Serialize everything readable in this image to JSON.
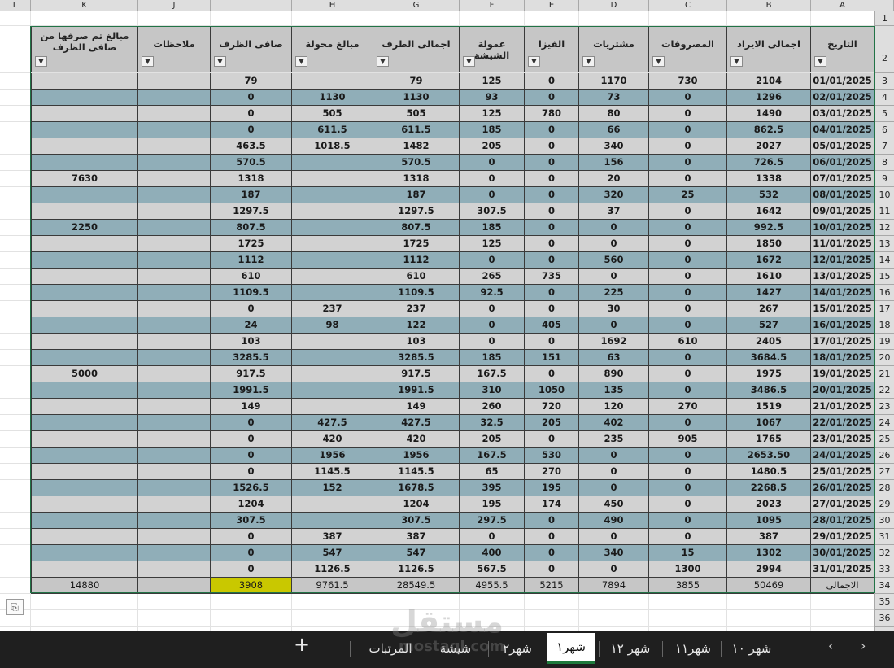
{
  "columns": [
    "L",
    "K",
    "J",
    "I",
    "H",
    "G",
    "F",
    "E",
    "D",
    "C",
    "B",
    "A"
  ],
  "headers": {
    "K": "مبالغ تم صرفها من صافى الظرف",
    "J": "ملاحظات",
    "I": "صافى الظرف",
    "H": "مبالغ محولة",
    "G": "اجمالى الظرف",
    "F": "عمولة الشيشة",
    "E": "الفيزا",
    "D": "مشتريات",
    "C": "المصروفات",
    "B": "اجمالى الايراد",
    "A": "التاريخ"
  },
  "row_numbers": [
    "1",
    "2",
    "3",
    "4",
    "5",
    "6",
    "7",
    "8",
    "9",
    "10",
    "11",
    "12",
    "13",
    "14",
    "15",
    "16",
    "17",
    "18",
    "19",
    "20",
    "21",
    "22",
    "23",
    "24",
    "25",
    "26",
    "27",
    "28",
    "29",
    "30",
    "31",
    "32",
    "33",
    "34",
    "35",
    "36",
    "37"
  ],
  "rows": [
    {
      "A": "01/01/2025",
      "B": "2104",
      "C": "730",
      "D": "1170",
      "E": "0",
      "F": "125",
      "G": "79",
      "H": "",
      "I": "79",
      "J": "",
      "K": ""
    },
    {
      "A": "02/01/2025",
      "B": "1296",
      "C": "0",
      "D": "73",
      "E": "0",
      "F": "93",
      "G": "1130",
      "H": "1130",
      "I": "0",
      "J": "",
      "K": ""
    },
    {
      "A": "03/01/2025",
      "B": "1490",
      "C": "0",
      "D": "80",
      "E": "780",
      "F": "125",
      "G": "505",
      "H": "505",
      "I": "0",
      "J": "",
      "K": ""
    },
    {
      "A": "04/01/2025",
      "B": "862.5",
      "C": "0",
      "D": "66",
      "E": "0",
      "F": "185",
      "G": "611.5",
      "H": "611.5",
      "I": "0",
      "J": "",
      "K": ""
    },
    {
      "A": "05/01/2025",
      "B": "2027",
      "C": "0",
      "D": "340",
      "E": "0",
      "F": "205",
      "G": "1482",
      "H": "1018.5",
      "I": "463.5",
      "J": "",
      "K": ""
    },
    {
      "A": "06/01/2025",
      "B": "726.5",
      "C": "0",
      "D": "156",
      "E": "0",
      "F": "0",
      "G": "570.5",
      "H": "",
      "I": "570.5",
      "J": "",
      "K": ""
    },
    {
      "A": "07/01/2025",
      "B": "1338",
      "C": "0",
      "D": "20",
      "E": "0",
      "F": "0",
      "G": "1318",
      "H": "",
      "I": "1318",
      "J": "",
      "K": "7630"
    },
    {
      "A": "08/01/2025",
      "B": "532",
      "C": "25",
      "D": "320",
      "E": "0",
      "F": "0",
      "G": "187",
      "H": "",
      "I": "187",
      "J": "",
      "K": ""
    },
    {
      "A": "09/01/2025",
      "B": "1642",
      "C": "0",
      "D": "37",
      "E": "0",
      "F": "307.5",
      "G": "1297.5",
      "H": "",
      "I": "1297.5",
      "J": "",
      "K": ""
    },
    {
      "A": "10/01/2025",
      "B": "992.5",
      "C": "0",
      "D": "0",
      "E": "0",
      "F": "185",
      "G": "807.5",
      "H": "",
      "I": "807.5",
      "J": "",
      "K": "2250"
    },
    {
      "A": "11/01/2025",
      "B": "1850",
      "C": "0",
      "D": "0",
      "E": "0",
      "F": "125",
      "G": "1725",
      "H": "",
      "I": "1725",
      "J": "",
      "K": ""
    },
    {
      "A": "12/01/2025",
      "B": "1672",
      "C": "0",
      "D": "560",
      "E": "0",
      "F": "0",
      "G": "1112",
      "H": "",
      "I": "1112",
      "J": "",
      "K": ""
    },
    {
      "A": "13/01/2025",
      "B": "1610",
      "C": "0",
      "D": "0",
      "E": "735",
      "F": "265",
      "G": "610",
      "H": "",
      "I": "610",
      "J": "",
      "K": ""
    },
    {
      "A": "14/01/2025",
      "B": "1427",
      "C": "0",
      "D": "225",
      "E": "0",
      "F": "92.5",
      "G": "1109.5",
      "H": "",
      "I": "1109.5",
      "J": "",
      "K": ""
    },
    {
      "A": "15/01/2025",
      "B": "267",
      "C": "0",
      "D": "30",
      "E": "0",
      "F": "0",
      "G": "237",
      "H": "237",
      "I": "0",
      "J": "",
      "K": ""
    },
    {
      "A": "16/01/2025",
      "B": "527",
      "C": "0",
      "D": "0",
      "E": "405",
      "F": "0",
      "G": "122",
      "H": "98",
      "I": "24",
      "J": "",
      "K": ""
    },
    {
      "A": "17/01/2025",
      "B": "2405",
      "C": "610",
      "D": "1692",
      "E": "0",
      "F": "0",
      "G": "103",
      "H": "",
      "I": "103",
      "J": "",
      "K": ""
    },
    {
      "A": "18/01/2025",
      "B": "3684.5",
      "C": "0",
      "D": "63",
      "E": "151",
      "F": "185",
      "G": "3285.5",
      "H": "",
      "I": "3285.5",
      "J": "",
      "K": ""
    },
    {
      "A": "19/01/2025",
      "B": "1975",
      "C": "0",
      "D": "890",
      "E": "0",
      "F": "167.5",
      "G": "917.5",
      "H": "",
      "I": "917.5",
      "J": "",
      "K": "5000"
    },
    {
      "A": "20/01/2025",
      "B": "3486.5",
      "C": "0",
      "D": "135",
      "E": "1050",
      "F": "310",
      "G": "1991.5",
      "H": "",
      "I": "1991.5",
      "J": "",
      "K": ""
    },
    {
      "A": "21/01/2025",
      "B": "1519",
      "C": "270",
      "D": "120",
      "E": "720",
      "F": "260",
      "G": "149",
      "H": "",
      "I": "149",
      "J": "",
      "K": ""
    },
    {
      "A": "22/01/2025",
      "B": "1067",
      "C": "0",
      "D": "402",
      "E": "205",
      "F": "32.5",
      "G": "427.5",
      "H": "427.5",
      "I": "0",
      "J": "",
      "K": ""
    },
    {
      "A": "23/01/2025",
      "B": "1765",
      "C": "905",
      "D": "235",
      "E": "0",
      "F": "205",
      "G": "420",
      "H": "420",
      "I": "0",
      "J": "",
      "K": ""
    },
    {
      "A": "24/01/2025",
      "B": "2653.50",
      "C": "0",
      "D": "0",
      "E": "530",
      "F": "167.5",
      "G": "1956",
      "H": "1956",
      "I": "0",
      "J": "",
      "K": ""
    },
    {
      "A": "25/01/2025",
      "B": "1480.5",
      "C": "0",
      "D": "0",
      "E": "270",
      "F": "65",
      "G": "1145.5",
      "H": "1145.5",
      "I": "0",
      "J": "",
      "K": ""
    },
    {
      "A": "26/01/2025",
      "B": "2268.5",
      "C": "0",
      "D": "0",
      "E": "195",
      "F": "395",
      "G": "1678.5",
      "H": "152",
      "I": "1526.5",
      "J": "",
      "K": ""
    },
    {
      "A": "27/01/2025",
      "B": "2023",
      "C": "0",
      "D": "450",
      "E": "174",
      "F": "195",
      "G": "1204",
      "H": "",
      "I": "1204",
      "J": "",
      "K": ""
    },
    {
      "A": "28/01/2025",
      "B": "1095",
      "C": "0",
      "D": "490",
      "E": "0",
      "F": "297.5",
      "G": "307.5",
      "H": "",
      "I": "307.5",
      "J": "",
      "K": ""
    },
    {
      "A": "29/01/2025",
      "B": "387",
      "C": "0",
      "D": "0",
      "E": "0",
      "F": "0",
      "G": "387",
      "H": "387",
      "I": "0",
      "J": "",
      "K": ""
    },
    {
      "A": "30/01/2025",
      "B": "1302",
      "C": "15",
      "D": "340",
      "E": "0",
      "F": "400",
      "G": "547",
      "H": "547",
      "I": "0",
      "J": "",
      "K": ""
    },
    {
      "A": "31/01/2025",
      "B": "2994",
      "C": "1300",
      "D": "0",
      "E": "0",
      "F": "567.5",
      "G": "1126.5",
      "H": "1126.5",
      "I": "0",
      "J": "",
      "K": ""
    }
  ],
  "totals": {
    "A": "الاجمالى",
    "B": "50469",
    "C": "3855",
    "D": "7894",
    "E": "5215",
    "F": "4955.5",
    "G": "28549.5",
    "H": "9761.5",
    "I": "3908",
    "J": "",
    "K": "14880"
  },
  "filter_icon": "dropdown-arrow-icon",
  "highlight_color": "#c9c800",
  "sheet_tabs": [
    "شهر ١٠",
    "شهر١١",
    "شهر ١٢",
    "شهر١",
    "شهر٢",
    "شيشة",
    "المرتبات"
  ],
  "active_tab": "شهر١",
  "add_sheet_label": "+",
  "nav_prev": "‹",
  "nav_next": "›",
  "watermark": {
    "arabic": "مستقل",
    "latin": "mostaql.com"
  }
}
